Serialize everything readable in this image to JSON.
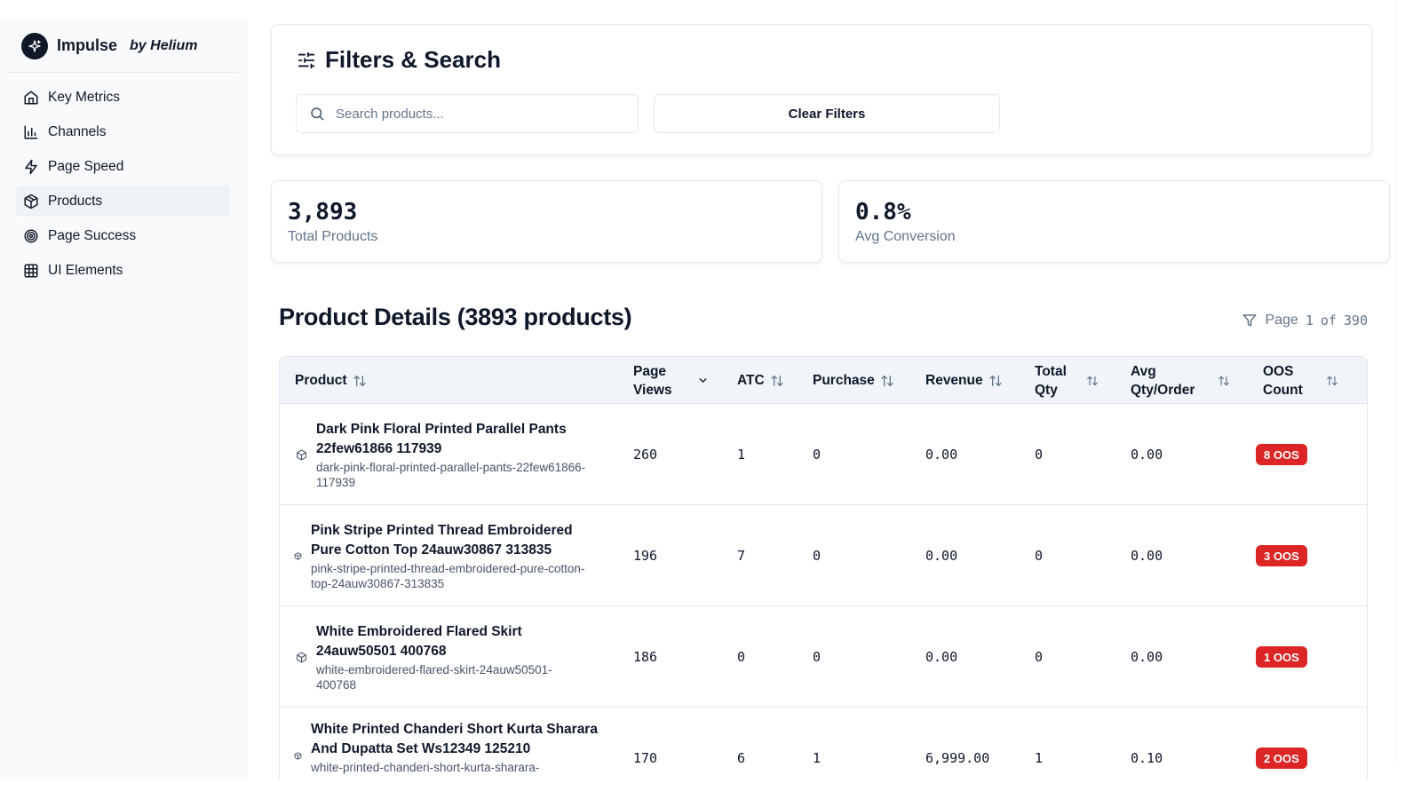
{
  "brand": {
    "name": "Impulse",
    "by": "by Helium"
  },
  "sidebar": {
    "items": [
      {
        "label": "Key Metrics",
        "icon": "home-icon"
      },
      {
        "label": "Channels",
        "icon": "bar-chart-icon"
      },
      {
        "label": "Page Speed",
        "icon": "lightning-icon"
      },
      {
        "label": "Products",
        "icon": "package-icon",
        "active": true
      },
      {
        "label": "Page Success",
        "icon": "target-icon"
      },
      {
        "label": "UI Elements",
        "icon": "grid-icon"
      }
    ]
  },
  "filters": {
    "title": "Filters & Search",
    "search_placeholder": "Search products...",
    "clear_label": "Clear Filters"
  },
  "stats": [
    {
      "value": "3,893",
      "label": "Total Products"
    },
    {
      "value": "0.8%",
      "label": "Avg Conversion"
    }
  ],
  "details": {
    "title": "Product Details (3893 products)",
    "page_label": "Page",
    "page_current": "1",
    "page_of": "of",
    "page_total": "390"
  },
  "table": {
    "columns": {
      "product": "Product",
      "page_views": "Page Views",
      "atc": "ATC",
      "purchase": "Purchase",
      "revenue": "Revenue",
      "total_qty": "Total Qty",
      "avg_qty": "Avg Qty/Order",
      "oos": "OOS Count"
    },
    "rows": [
      {
        "name": "Dark Pink Floral Printed Parallel Pants 22few61866 117939",
        "slug": "dark-pink-floral-printed-parallel-pants-22few61866-117939",
        "page_views": "260",
        "atc": "1",
        "purchase": "0",
        "revenue": "0.00",
        "total_qty": "0",
        "avg_qty": "0.00",
        "oos": "8 OOS"
      },
      {
        "name": "Pink Stripe Printed Thread Embroidered Pure Cotton Top 24auw30867 313835",
        "slug": "pink-stripe-printed-thread-embroidered-pure-cotton-top-24auw30867-313835",
        "page_views": "196",
        "atc": "7",
        "purchase": "0",
        "revenue": "0.00",
        "total_qty": "0",
        "avg_qty": "0.00",
        "oos": "3 OOS"
      },
      {
        "name": "White Embroidered Flared Skirt 24auw50501 400768",
        "slug": "white-embroidered-flared-skirt-24auw50501-400768",
        "page_views": "186",
        "atc": "0",
        "purchase": "0",
        "revenue": "0.00",
        "total_qty": "0",
        "avg_qty": "0.00",
        "oos": "1 OOS"
      },
      {
        "name": "White Printed Chanderi Short Kurta Sharara And Dupatta Set Ws12349 125210",
        "slug": "white-printed-chanderi-short-kurta-sharara-",
        "page_views": "170",
        "atc": "6",
        "purchase": "1",
        "revenue": "6,999.00",
        "total_qty": "1",
        "avg_qty": "0.10",
        "oos": "2 OOS"
      }
    ]
  },
  "colors": {
    "oos_badge": "#dc2626",
    "active_nav": "#eef2f7",
    "header_bg": "#f1f5f9"
  }
}
